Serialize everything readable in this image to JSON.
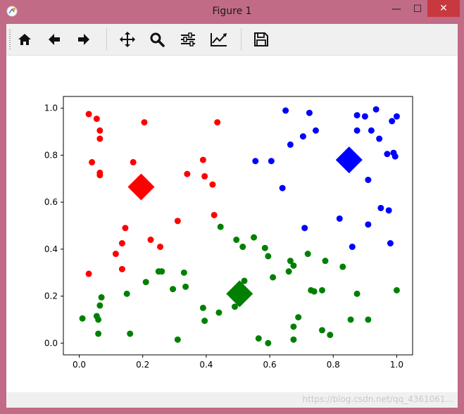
{
  "window": {
    "title": "Figure 1",
    "controls": {
      "minimize": "—",
      "maximize": "☐",
      "close": "✕"
    }
  },
  "toolbar": {
    "items": [
      {
        "name": "home",
        "icon": "home-icon"
      },
      {
        "name": "back",
        "icon": "arrow-left-icon"
      },
      {
        "name": "forward",
        "icon": "arrow-right-icon"
      },
      {
        "name": "pan",
        "icon": "move-icon"
      },
      {
        "name": "zoom",
        "icon": "magnifier-icon"
      },
      {
        "name": "subplots",
        "icon": "sliders-icon"
      },
      {
        "name": "edit-axis",
        "icon": "line-chart-icon"
      },
      {
        "name": "save",
        "icon": "floppy-disk-icon"
      }
    ]
  },
  "status": {
    "watermark": "https://blog.csdn.net/qq_4361061..."
  },
  "chart_data": {
    "type": "scatter",
    "xlim": [
      -0.05,
      1.05
    ],
    "ylim": [
      -0.05,
      1.05
    ],
    "xticks": [
      "0.0",
      "0.2",
      "0.4",
      "0.6",
      "0.8",
      "1.0"
    ],
    "xtick_values": [
      0.0,
      0.2,
      0.4,
      0.6,
      0.8,
      1.0
    ],
    "yticks": [
      "0.0",
      "0.2",
      "0.4",
      "0.6",
      "0.8",
      "1.0"
    ],
    "ytick_values": [
      0.0,
      0.2,
      0.4,
      0.6,
      0.8,
      1.0
    ],
    "grid": false,
    "series": [
      {
        "color": "#ff0000",
        "points": [
          [
            0.03,
            0.975
          ],
          [
            0.055,
            0.955
          ],
          [
            0.065,
            0.905
          ],
          [
            0.065,
            0.87
          ],
          [
            0.205,
            0.94
          ],
          [
            0.435,
            0.94
          ],
          [
            0.04,
            0.77
          ],
          [
            0.065,
            0.725
          ],
          [
            0.065,
            0.715
          ],
          [
            0.17,
            0.77
          ],
          [
            0.39,
            0.78
          ],
          [
            0.34,
            0.72
          ],
          [
            0.395,
            0.71
          ],
          [
            0.42,
            0.675
          ],
          [
            0.425,
            0.545
          ],
          [
            0.31,
            0.52
          ],
          [
            0.145,
            0.49
          ],
          [
            0.135,
            0.425
          ],
          [
            0.225,
            0.44
          ],
          [
            0.255,
            0.41
          ],
          [
            0.115,
            0.38
          ],
          [
            0.135,
            0.315
          ],
          [
            0.03,
            0.295
          ]
        ],
        "center": [
          0.195,
          0.665
        ]
      },
      {
        "color": "#0000ff",
        "points": [
          [
            0.65,
            0.99
          ],
          [
            0.725,
            0.98
          ],
          [
            0.935,
            0.995
          ],
          [
            0.875,
            0.97
          ],
          [
            0.9,
            0.965
          ],
          [
            1.0,
            0.965
          ],
          [
            0.985,
            0.945
          ],
          [
            0.745,
            0.905
          ],
          [
            0.875,
            0.905
          ],
          [
            0.92,
            0.905
          ],
          [
            0.705,
            0.88
          ],
          [
            0.945,
            0.87
          ],
          [
            0.665,
            0.845
          ],
          [
            0.97,
            0.805
          ],
          [
            0.99,
            0.81
          ],
          [
            0.995,
            0.795
          ],
          [
            0.555,
            0.775
          ],
          [
            0.605,
            0.775
          ],
          [
            0.91,
            0.695
          ],
          [
            0.64,
            0.66
          ],
          [
            0.95,
            0.575
          ],
          [
            0.975,
            0.565
          ],
          [
            0.82,
            0.53
          ],
          [
            0.91,
            0.505
          ],
          [
            0.71,
            0.49
          ],
          [
            0.98,
            0.425
          ],
          [
            0.86,
            0.41
          ]
        ],
        "center": [
          0.85,
          0.78
        ]
      },
      {
        "color": "#008000",
        "points": [
          [
            0.445,
            0.495
          ],
          [
            0.495,
            0.44
          ],
          [
            0.55,
            0.45
          ],
          [
            0.515,
            0.41
          ],
          [
            0.585,
            0.405
          ],
          [
            0.595,
            0.37
          ],
          [
            0.665,
            0.35
          ],
          [
            0.72,
            0.38
          ],
          [
            0.675,
            0.33
          ],
          [
            0.83,
            0.325
          ],
          [
            0.66,
            0.305
          ],
          [
            0.775,
            0.35
          ],
          [
            0.25,
            0.305
          ],
          [
            0.26,
            0.305
          ],
          [
            0.33,
            0.3
          ],
          [
            0.61,
            0.28
          ],
          [
            0.21,
            0.26
          ],
          [
            0.52,
            0.265
          ],
          [
            0.335,
            0.24
          ],
          [
            0.295,
            0.23
          ],
          [
            0.73,
            0.225
          ],
          [
            0.74,
            0.22
          ],
          [
            0.765,
            0.225
          ],
          [
            0.875,
            0.21
          ],
          [
            1.0,
            0.225
          ],
          [
            0.15,
            0.21
          ],
          [
            0.07,
            0.195
          ],
          [
            0.065,
            0.16
          ],
          [
            0.39,
            0.15
          ],
          [
            0.44,
            0.13
          ],
          [
            0.49,
            0.155
          ],
          [
            0.01,
            0.105
          ],
          [
            0.055,
            0.115
          ],
          [
            0.06,
            0.1
          ],
          [
            0.395,
            0.095
          ],
          [
            0.69,
            0.11
          ],
          [
            0.855,
            0.1
          ],
          [
            0.91,
            0.1
          ],
          [
            0.675,
            0.07
          ],
          [
            0.16,
            0.04
          ],
          [
            0.06,
            0.04
          ],
          [
            0.765,
            0.055
          ],
          [
            0.79,
            0.035
          ],
          [
            0.31,
            0.015
          ],
          [
            0.565,
            0.02
          ],
          [
            0.595,
            0.0
          ],
          [
            0.675,
            0.015
          ]
        ],
        "center": [
          0.505,
          0.21
        ]
      }
    ]
  }
}
